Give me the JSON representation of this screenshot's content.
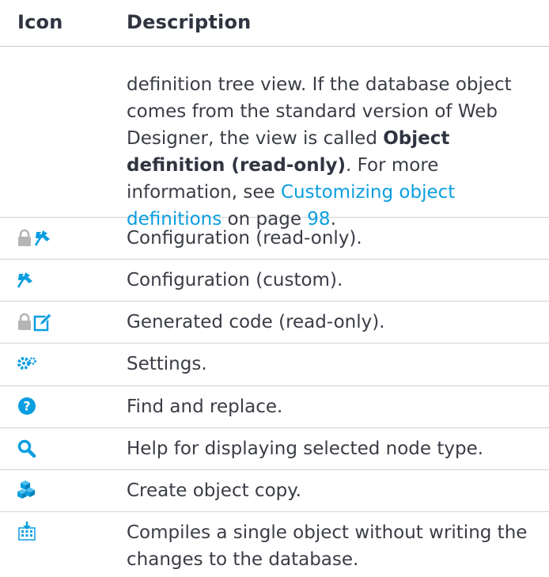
{
  "header": {
    "icon_col": "Icon",
    "desc_col": "Description"
  },
  "continuation": {
    "text_1": "definition tree view. If the database object comes from the standard version of Web Designer, the view is called ",
    "bold": "Object definition (read-only)",
    "text_2": ". For more information, see ",
    "link": "Customizing object definitions",
    "text_3": " on page ",
    "page_link": "98",
    "text_4": "."
  },
  "rows": [
    {
      "icon": "lock-config-icon",
      "description": "Configuration (read-only)."
    },
    {
      "icon": "config-icon",
      "description": "Configuration (custom)."
    },
    {
      "icon": "lock-edit-icon",
      "description": "Generated code (read-only)."
    },
    {
      "icon": "settings-icon",
      "description": "Settings."
    },
    {
      "icon": "help-icon",
      "description": "Find and replace."
    },
    {
      "icon": "search-icon",
      "description": "Help for displaying selected node type."
    },
    {
      "icon": "cubes-icon",
      "description": "Create object copy."
    },
    {
      "icon": "compile-icon",
      "description": "Compiles a single object without writing the changes to the database."
    }
  ],
  "colors": {
    "accent": "#0a9ee0",
    "icon_gray": "#b5b5b5",
    "text": "#3a3d45"
  }
}
